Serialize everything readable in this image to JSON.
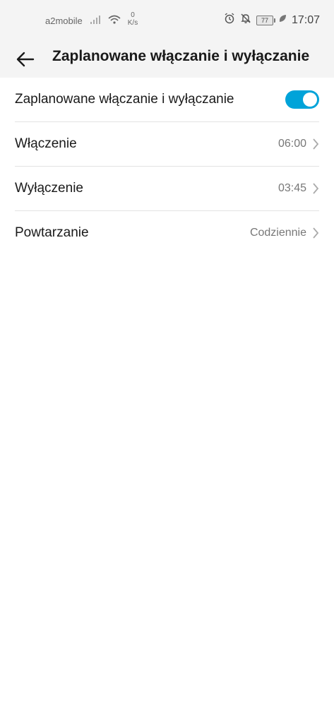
{
  "status_bar": {
    "carrier": "a2mobile",
    "speed_value": "0",
    "speed_unit": "K/s",
    "battery_level": "77",
    "time": "17:07",
    "icons": [
      "signal-icon",
      "wifi-icon",
      "alarm-icon",
      "bell-off-icon",
      "battery-icon",
      "leaf-icon"
    ]
  },
  "header": {
    "title": "Zaplanowane włączanie i wyłączanie",
    "back_icon": "back-arrow-icon"
  },
  "settings": {
    "toggle_row": {
      "label": "Zaplanowane włączanie i wyłączanie",
      "enabled": true
    },
    "power_on": {
      "label": "Włączenie",
      "value": "06:00"
    },
    "power_off": {
      "label": "Wyłączenie",
      "value": "03:45"
    },
    "repeat": {
      "label": "Powtarzanie",
      "value": "Codziennie"
    }
  },
  "colors": {
    "accent": "#00a3d9",
    "header_bg": "#f4f4f4",
    "divider": "#e3e3e3"
  }
}
